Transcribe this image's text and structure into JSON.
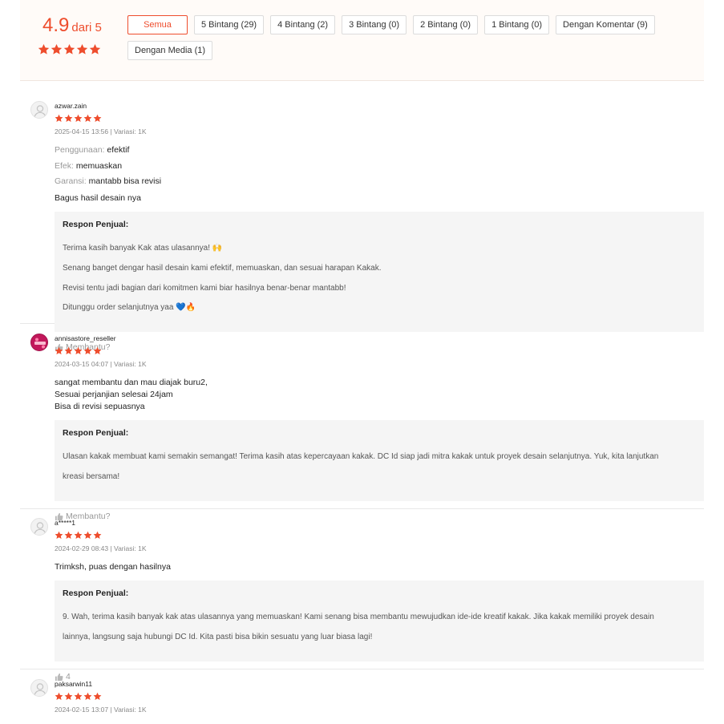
{
  "summary": {
    "score": "4.9",
    "of_label": "dari 5",
    "star_count": 5
  },
  "filters": [
    {
      "label": "Semua",
      "active": true
    },
    {
      "label": "5 Bintang (29)"
    },
    {
      "label": "4 Bintang (2)"
    },
    {
      "label": "3 Bintang (0)"
    },
    {
      "label": "2 Bintang (0)"
    },
    {
      "label": "1 Bintang (0)"
    },
    {
      "label": "Dengan Komentar (9)"
    },
    {
      "label": "Dengan Media (1)"
    }
  ],
  "reviews": [
    {
      "username": "azwar.zain",
      "rating": 5,
      "meta": "2025-04-15 13:56 | Variasi: 1K",
      "attributes": [
        {
          "key": "Penggunaan:",
          "value": "efektif"
        },
        {
          "key": "Efek:",
          "value": "memuaskan"
        },
        {
          "key": "Garansi:",
          "value": "mantabb bisa revisi"
        }
      ],
      "comment": "Bagus hasil desain nya",
      "response_title": "Respon Penjual:",
      "response_lines": [
        "Terima kasih banyak Kak atas ulasannya! 🙌",
        "Senang banget dengar hasil desain kami efektif, memuaskan, dan sesuai harapan Kakak.",
        "Revisi tentu jadi bagian dari komitmen kami biar hasilnya benar-benar mantabb!",
        "Ditunggu order selanjutnya yaa 💙🔥"
      ],
      "helpful": "Membantu?"
    },
    {
      "username": "annisastore_reseller",
      "rating": 5,
      "meta": "2024-03-15 04:07 | Variasi: 1K",
      "comment_lines": [
        "sangat membantu dan mau diajak buru2,",
        "Sesuai perjanjian selesai 24jam",
        "Bisa di revisi sepuasnya"
      ],
      "response_title": "Respon Penjual:",
      "response_lines": [
        "Ulasan kakak membuat kami semakin semangat! Terima kasih atas kepercayaan kakak. DC Id siap jadi mitra kakak untuk proyek desain selanjutnya. Yuk, kita lanjutkan",
        "kreasi bersama!"
      ],
      "helpful": "Membantu?"
    },
    {
      "username": "a*****1",
      "rating": 5,
      "meta": "2024-02-29 08:43 | Variasi: 1K",
      "comment": "Trimksh, puas dengan hasilnya",
      "response_title": "Respon Penjual:",
      "response_lines": [
        "9. Wah, terima kasih banyak kak atas ulasannya yang memuaskan! Kami senang bisa membantu mewujudkan ide-ide kreatif kakak. Jika kakak memiliki proyek desain",
        "lainnya, langsung saja hubungi DC Id. Kita pasti bisa bikin sesuatu yang luar biasa lagi!"
      ],
      "helpful": "4"
    },
    {
      "username": "paksarwin11",
      "rating": 5,
      "meta": "2024-02-15 13:07 | Variasi: 1K"
    }
  ],
  "colors": {
    "accent": "#ee4d2d",
    "star": "#ee4d2d",
    "summary_bg": "#fffbf8",
    "response_bg": "#f5f5f5"
  },
  "icons": {
    "star": "star-icon",
    "avatar": "user-avatar-icon",
    "helpful": "thumbs-up-icon"
  }
}
